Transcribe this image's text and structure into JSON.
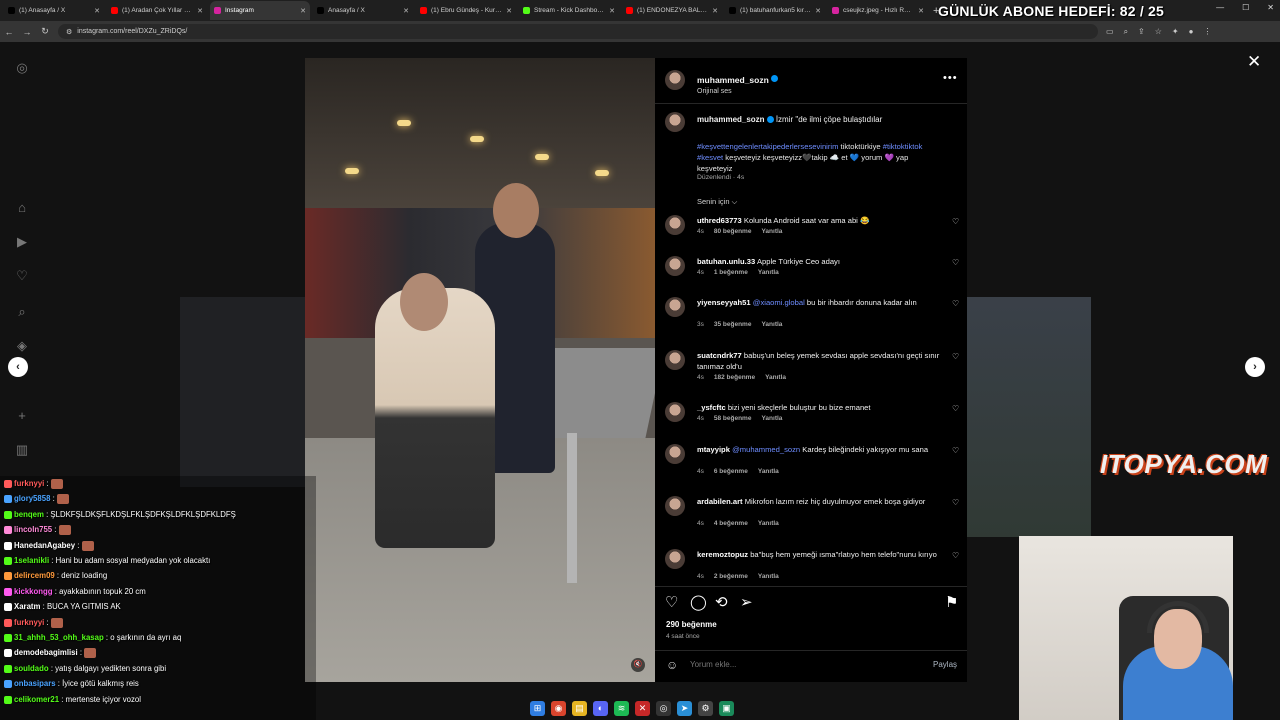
{
  "browser": {
    "tabs": [
      {
        "label": "(1) Anasayfa / X",
        "color": "#000000"
      },
      {
        "label": "(1) Aradan Çok Yıllar Geçti",
        "color": "#ff0000"
      },
      {
        "label": "Instagram",
        "color": "#d6249f"
      },
      {
        "label": "Anasayfa / X",
        "color": "#000000"
      },
      {
        "label": "(1) Ebru Gündeş - Kurşun",
        "color": "#ff0000"
      },
      {
        "label": "Stream - Kick Dashboard",
        "color": "#53fc18"
      },
      {
        "label": "(1) ENDONEZYA BALİBU",
        "color": "#ff0000"
      },
      {
        "label": "(1) batuhanfurkan5 kırmızı",
        "color": "#000000"
      },
      {
        "label": "cseujkz.jpeg - Hızlı Resim",
        "color": "#d6249f"
      }
    ],
    "new_tab": "+",
    "url": "instagram.com/reel/DXZu_ZRiDQs/"
  },
  "overlay": {
    "goal_text": "GÜNLÜK ABONE HEDEFİ: 82 / 25",
    "logo_text": "ITOPYA.COM"
  },
  "post": {
    "author": "muhammed_sozn",
    "audio": "Orijinal ses",
    "caption_text": "İzmir \"de ilmi çöpe bulaştıdılar",
    "hashtags_blue": "#keşvettengelenlertakipederlersesevinirim",
    "hashtags_rest_1": "tiktoktürkiye",
    "hashtags_blue_2": "#tiktoktiktok #kesvet",
    "hashtags_rest_2": "keşveteyiz keşveteyizz🖤takip ☁️ et 💙 yorum 💜 yap keşveteyiz",
    "edited": "Düzenlendi · 4s",
    "for_you": "Senin için ⌵",
    "likes": "290 beğenme",
    "time_ago": "4 saat önce",
    "comment_placeholder": "Yorum ekle...",
    "share_label": "Paylaş"
  },
  "comments": [
    {
      "user": "uthred63773",
      "text": "Kolunda Android saat var ama abi 😂",
      "mention": "",
      "age": "4s",
      "likes": "80 beğenme",
      "reply": "Yanıtla"
    },
    {
      "user": "batuhan.unlu.33",
      "text": "Apple Türkiye Ceo adayı",
      "mention": "",
      "age": "4s",
      "likes": "1 beğenme",
      "reply": "Yanıtla"
    },
    {
      "user": "yiyenseyyah51",
      "text": "bu bir ihbardır donuna kadar alın",
      "mention": "@xiaomi.global",
      "age": "3s",
      "likes": "35 beğenme",
      "reply": "Yanıtla"
    },
    {
      "user": "suatcndrk77",
      "text": "babuş'un beleş yemek sevdası apple sevdası'nı geçti sınır tanımaz old'u",
      "mention": "",
      "age": "4s",
      "likes": "182 beğenme",
      "reply": "Yanıtla"
    },
    {
      "user": "_ysfcftc",
      "text": "bizi yeni skeçlerle buluştur bu bize emanet",
      "mention": "",
      "age": "4s",
      "likes": "58 beğenme",
      "reply": "Yanıtla"
    },
    {
      "user": "mtayyipk",
      "text": "Kardeş bileğindeki yakışıyor mu sana",
      "mention": "@muhammed_sozn",
      "age": "4s",
      "likes": "6 beğenme",
      "reply": "Yanıtla"
    },
    {
      "user": "ardabilen.art",
      "text": "Mikrofon lazım reiz hiç duyulmuyor emek boşa gidiyor",
      "mention": "",
      "age": "4s",
      "likes": "4 beğenme",
      "reply": "Yanıtla"
    },
    {
      "user": "keremoztopuz",
      "text": "ba\"buş hem yemeği ısma\"rlatıyo hem telefo\"nunu kırıyo",
      "mention": "",
      "age": "4s",
      "likes": "2 beğenme",
      "reply": "Yanıtla"
    }
  ],
  "chat": [
    {
      "user": "furknyyi",
      "text": "",
      "emote": true,
      "color": "#ff5a5a"
    },
    {
      "user": "glory5858",
      "text": "",
      "emote": true,
      "color": "#4aa3ff"
    },
    {
      "user": "benqem",
      "text": "ŞLDKFŞLDKŞFLKDŞLFKLŞDFKŞLDFKLŞDFKLDFŞ",
      "emote": false,
      "color": "#53fc18"
    },
    {
      "user": "lincoln755",
      "text": "",
      "emote": true,
      "color": "#ff8ad8"
    },
    {
      "user": "HanedanAgabey",
      "text": "",
      "emote": true,
      "color": "#ffffff"
    },
    {
      "user": "1selanikli",
      "text": "Hani bu adam sosyal medyadan yok olacaktı",
      "emote": false,
      "color": "#53fc18"
    },
    {
      "user": "delircem09",
      "text": "deniz loading",
      "emote": false,
      "color": "#ff9a3c"
    },
    {
      "user": "kickkongg",
      "text": "ayakkabının topuk 20 cm",
      "emote": false,
      "color": "#ff5af0"
    },
    {
      "user": "Xaratm",
      "text": "BUCA YA GITMIS AK",
      "emote": false,
      "color": "#ffffff"
    },
    {
      "user": "furknyyi",
      "text": "",
      "emote": true,
      "color": "#ff5a5a"
    },
    {
      "user": "31_ahhh_53_ohh_kasap",
      "text": "o şarkının da ayrı aq",
      "emote": false,
      "color": "#53fc18"
    },
    {
      "user": "demodebagimlisi",
      "text": "",
      "emote": true,
      "color": "#ffffff"
    },
    {
      "user": "souldado",
      "text": "yatış dalgayı yedikten sonra gibi",
      "emote": false,
      "color": "#53fc18"
    },
    {
      "user": "onbasipars",
      "text": "İyice götü kalkmış reis",
      "emote": false,
      "color": "#4aa3ff"
    },
    {
      "user": "celikomer21",
      "text": "mertenste içiyor vozol",
      "emote": false,
      "color": "#53fc18"
    }
  ]
}
